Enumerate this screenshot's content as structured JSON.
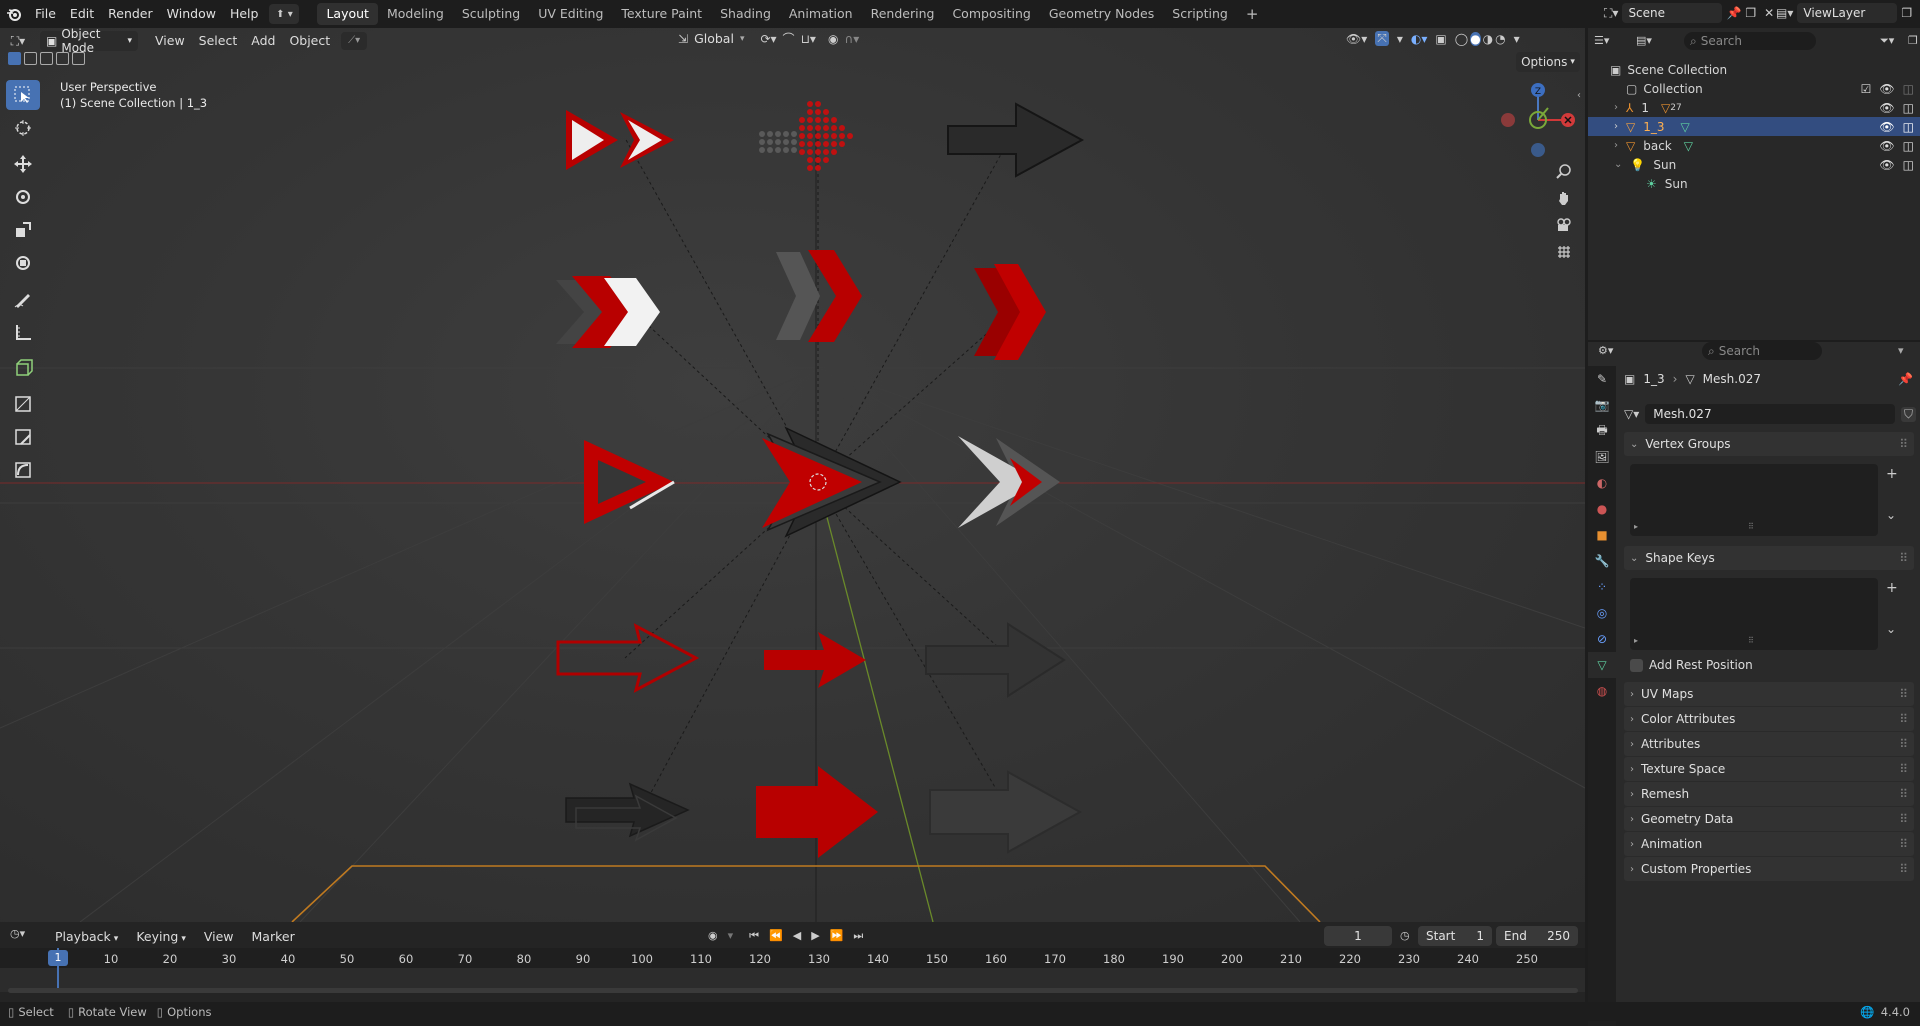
{
  "app": {
    "version": "4.4.0"
  },
  "topbar": {
    "menus": [
      "File",
      "Edit",
      "Render",
      "Window",
      "Help"
    ],
    "workspaces": [
      "Layout",
      "Modeling",
      "Sculpting",
      "UV Editing",
      "Texture Paint",
      "Shading",
      "Animation",
      "Rendering",
      "Compositing",
      "Geometry Nodes",
      "Scripting"
    ],
    "active_workspace": "Layout",
    "scene": "Scene",
    "view_layer": "ViewLayer"
  },
  "viewport": {
    "mode": "Object Mode",
    "menus": [
      "View",
      "Select",
      "Add",
      "Object"
    ],
    "orientation": "Global",
    "options_label": "Options",
    "overlay_line1": "User Perspective",
    "overlay_line2": "(1) Scene Collection | 1_3",
    "gizmo_z": "Z"
  },
  "outliner": {
    "search_placeholder": "Search",
    "root": "Scene Collection",
    "collection": "Collection",
    "items": [
      {
        "label": "1",
        "badge": "27"
      },
      {
        "label": "1_3"
      },
      {
        "label": "back"
      },
      {
        "label": "Sun"
      }
    ],
    "sun_child": "Sun"
  },
  "properties": {
    "search_placeholder": "Search",
    "breadcrumb_object": "1_3",
    "breadcrumb_mesh": "Mesh.027",
    "mesh_name": "Mesh.027",
    "panels_top": [
      "Vertex Groups",
      "Shape Keys"
    ],
    "add_rest_position": "Add Rest Position",
    "panels_collapsed": [
      "UV Maps",
      "Color Attributes",
      "Attributes",
      "Texture Space",
      "Remesh",
      "Geometry Data",
      "Animation",
      "Custom Properties"
    ]
  },
  "timeline": {
    "menus": [
      "Playback",
      "Keying",
      "View",
      "Marker"
    ],
    "current_frame": "1",
    "start_label": "Start",
    "start": "1",
    "end_label": "End",
    "end": "250",
    "ticks": [
      "1",
      "10",
      "20",
      "30",
      "40",
      "50",
      "60",
      "70",
      "80",
      "90",
      "100",
      "110",
      "120",
      "130",
      "140",
      "150",
      "160",
      "170",
      "180",
      "190",
      "200",
      "210",
      "220",
      "230",
      "240",
      "250"
    ]
  },
  "status": {
    "select": "Select",
    "rotate": "Rotate View",
    "options": "Options",
    "version": "4.4.0"
  },
  "colors": {
    "accent": "#4772b3",
    "arrow_red": "#b80000",
    "selection": "#334d80"
  }
}
